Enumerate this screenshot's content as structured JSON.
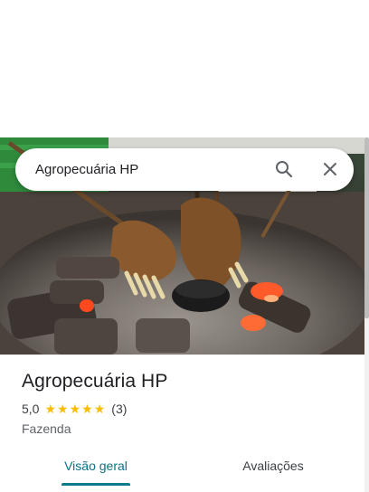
{
  "search": {
    "query": "Agropecuária HP"
  },
  "place": {
    "name": "Agropecuária HP",
    "rating": "5,0",
    "review_count": "(3)",
    "stars": 5,
    "category": "Fazenda"
  },
  "tabs": [
    {
      "label": "Visão geral",
      "active": true
    },
    {
      "label": "Avaliações",
      "active": false
    }
  ],
  "colors": {
    "star": "#fbbc04",
    "active_tab": "#0b7285",
    "indicator": "#0b7a8a"
  },
  "icons": {
    "search": "search-icon",
    "close": "close-icon"
  }
}
